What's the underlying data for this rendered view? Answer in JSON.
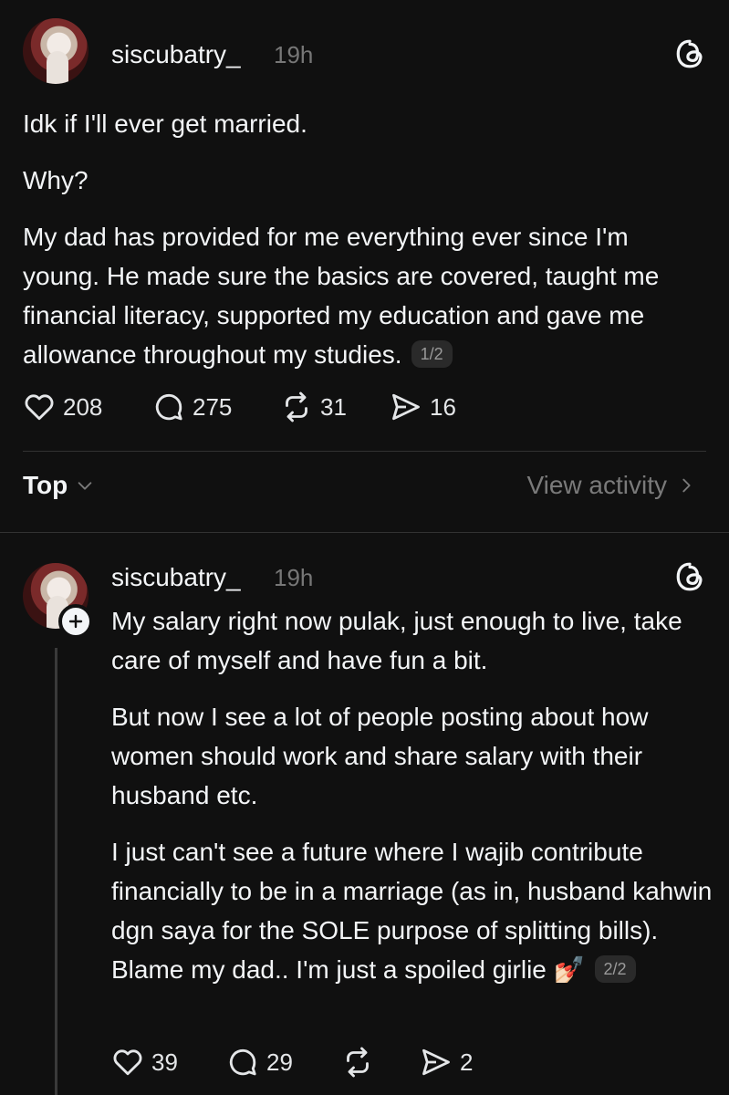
{
  "post1": {
    "username": "siscubatry_",
    "time": "19h",
    "paragraphs": [
      "Idk if I'll ever get married.",
      "Why?",
      "My dad has provided for me everything ever since I'm young. He made sure the basics are covered, taught me financial literacy, supported my education and gave me allowance throughout my studies."
    ],
    "page_badge": "1/2",
    "likes": "208",
    "replies": "275",
    "reposts": "31",
    "shares": "16"
  },
  "sort_bar": {
    "sort_label": "Top",
    "view_activity_label": "View activity"
  },
  "post2": {
    "username": "siscubatry_",
    "time": "19h",
    "paragraphs": [
      "My salary right now pulak, just enough to live, take care of myself and have fun a bit.",
      "But now I see a lot of people posting about how women should work and share salary with their husband etc.",
      "I just can't see a future where I wajib contribute financially to be in a marriage (as in, husband kahwin dgn saya for the SOLE purpose of splitting bills). Blame my dad.. I'm just a spoiled girlie"
    ],
    "emoji": "💅🏻",
    "page_badge": "2/2",
    "likes": "39",
    "replies": "29",
    "shares": "2"
  },
  "icons": {
    "threads_logo": "threads-logo-icon",
    "like": "heart-icon",
    "reply": "comment-bubble-icon",
    "repost": "repost-icon",
    "share": "send-icon",
    "chevron_down": "chevron-down-icon",
    "chevron_right": "chevron-right-icon",
    "follow": "plus-icon"
  },
  "colors": {
    "background": "#101010",
    "text": "#f3f5f7",
    "muted": "#777777",
    "divider": "#323232"
  }
}
